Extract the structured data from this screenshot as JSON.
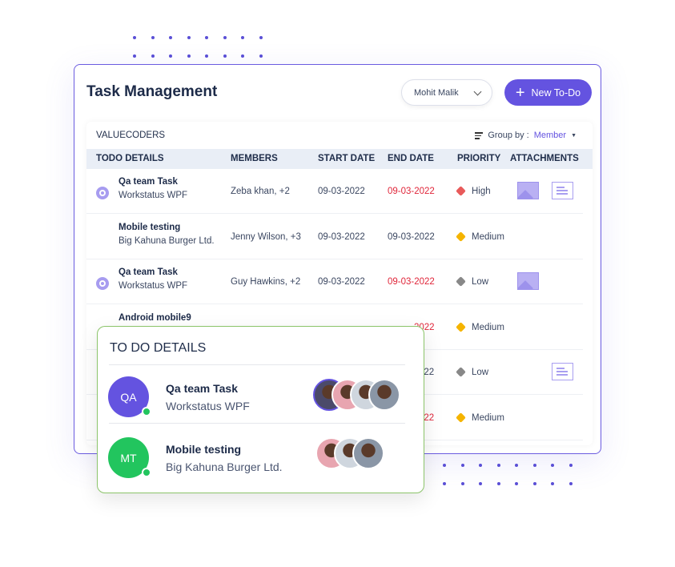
{
  "header": {
    "title": "Task Management",
    "user_dropdown": "Mohit Malik",
    "new_button": "New To-Do"
  },
  "panel": {
    "org": "VALUECODERS",
    "group_by_label": "Group by :",
    "group_by_value": "Member",
    "columns": [
      "TODO DETAILS",
      "MEMBERS",
      "START DATE",
      "END DATE",
      "PRIORITY",
      "ATTACHMENTS"
    ],
    "rows": [
      {
        "title": "Qa team Task",
        "subtitle": "Workstatus WPF",
        "members": "Zeba khan, +2",
        "start": "09-03-2022",
        "end": "09-03-2022",
        "priority": "High",
        "end_overdue": true,
        "attachments": [
          "image-icon",
          "document-icon"
        ],
        "synced": true
      },
      {
        "title": "Mobile testing",
        "subtitle": "Big Kahuna Burger Ltd.",
        "members": "Jenny Wilson, +3",
        "start": "09-03-2022",
        "end": "09-03-2022",
        "priority": "Medium",
        "end_overdue": false,
        "attachments": []
      },
      {
        "title": "Qa team Task",
        "subtitle": "Workstatus WPF",
        "members": "Guy Hawkins, +2",
        "start": "09-03-2022",
        "end": "09-03-2022",
        "priority": "Low",
        "end_overdue": true,
        "attachments": [
          "image-icon"
        ],
        "synced": true
      },
      {
        "title": "Android mobile9",
        "end": "2022",
        "priority": "Medium"
      },
      {
        "end": "022",
        "priority": "Low",
        "attachments": [
          "document-icon"
        ]
      },
      {
        "end": "022",
        "priority": "Medium"
      }
    ]
  },
  "popup": {
    "title": "TO DO DETAILS",
    "items": [
      {
        "initials": "QA",
        "name": "Qa team Task",
        "org": "Workstatus WPF",
        "color": "#6453e0",
        "avatars": 4
      },
      {
        "initials": "MT",
        "name": "Mobile testing",
        "org": "Big Kahuna Burger Ltd.",
        "color": "#22c55e",
        "avatars": 3
      }
    ]
  },
  "colors": {
    "accent": "#6453e0",
    "overdue": "#e0263a",
    "high": "#e85a5a",
    "medium": "#f5b400",
    "low": "#888888",
    "popup_border": "#8cc46a"
  }
}
